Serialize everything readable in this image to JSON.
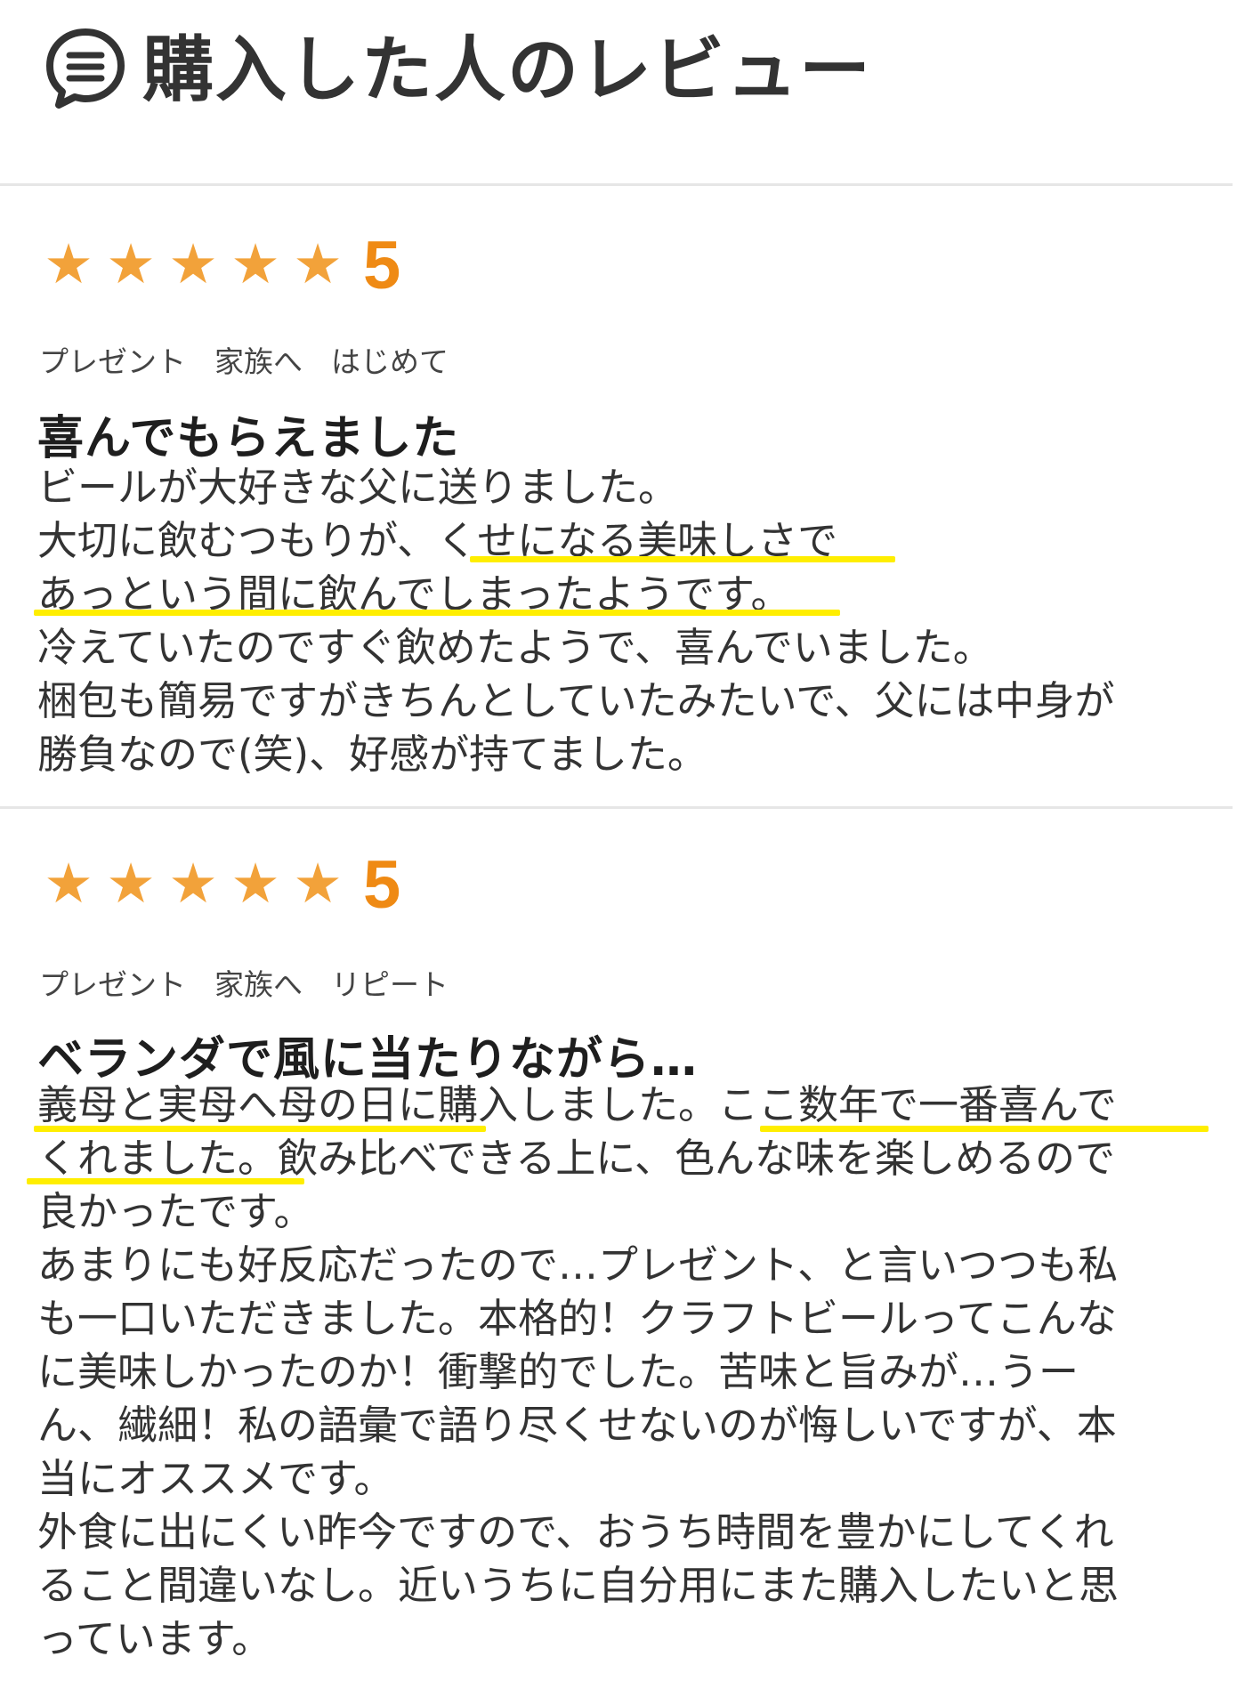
{
  "header": {
    "title": "購入した人のレビュー",
    "icon": "chat-bubble-icon"
  },
  "colors": {
    "star": "#f2a23a",
    "rating": "#ef8a14",
    "highlight": "#ffee00",
    "divider": "#e6e6e6"
  },
  "reviews": [
    {
      "stars": 5,
      "rating_label": "5",
      "star_glyph": "★",
      "tags": [
        "プレゼント",
        "家族へ",
        "はじめて"
      ],
      "title": "喜んでもらえました",
      "lines": [
        "ビールが大好きな父に送りました。",
        "大切に飲むつもりが、くせになる美味しさで",
        "あっという間に飲んでしまったようです。",
        "冷えていたのですぐ飲めたようで、喜んでいました。",
        "梱包も簡易ですがきちんとしていたみたいで、父には中身が",
        "勝負なので(笑)、好感が持てました。"
      ]
    },
    {
      "stars": 5,
      "rating_label": "5",
      "star_glyph": "★",
      "tags": [
        "プレゼント",
        "家族へ",
        "リピート"
      ],
      "title": "ベランダで風に当たりながら…",
      "lines": [
        "義母と実母へ母の日に購入しました。ここ数年で一番喜んで",
        "くれました。飲み比べできる上に、色んな味を楽しめるので",
        "良かったです。",
        "あまりにも好反応だったので…プレゼント、と言いつつも私",
        "も一口いただきました。本格的！クラフトビールってこんな",
        "に美味しかったのか！衝撃的でした。苦味と旨みが…うー",
        "ん、繊細！私の語彙で語り尽くせないのが悔しいですが、本",
        "当にオススメです。",
        "外食に出にくい昨今ですので、おうち時間を豊かにしてくれ",
        "ること間違いなし。近いうちに自分用にまた購入したいと思",
        "っています。"
      ]
    }
  ]
}
